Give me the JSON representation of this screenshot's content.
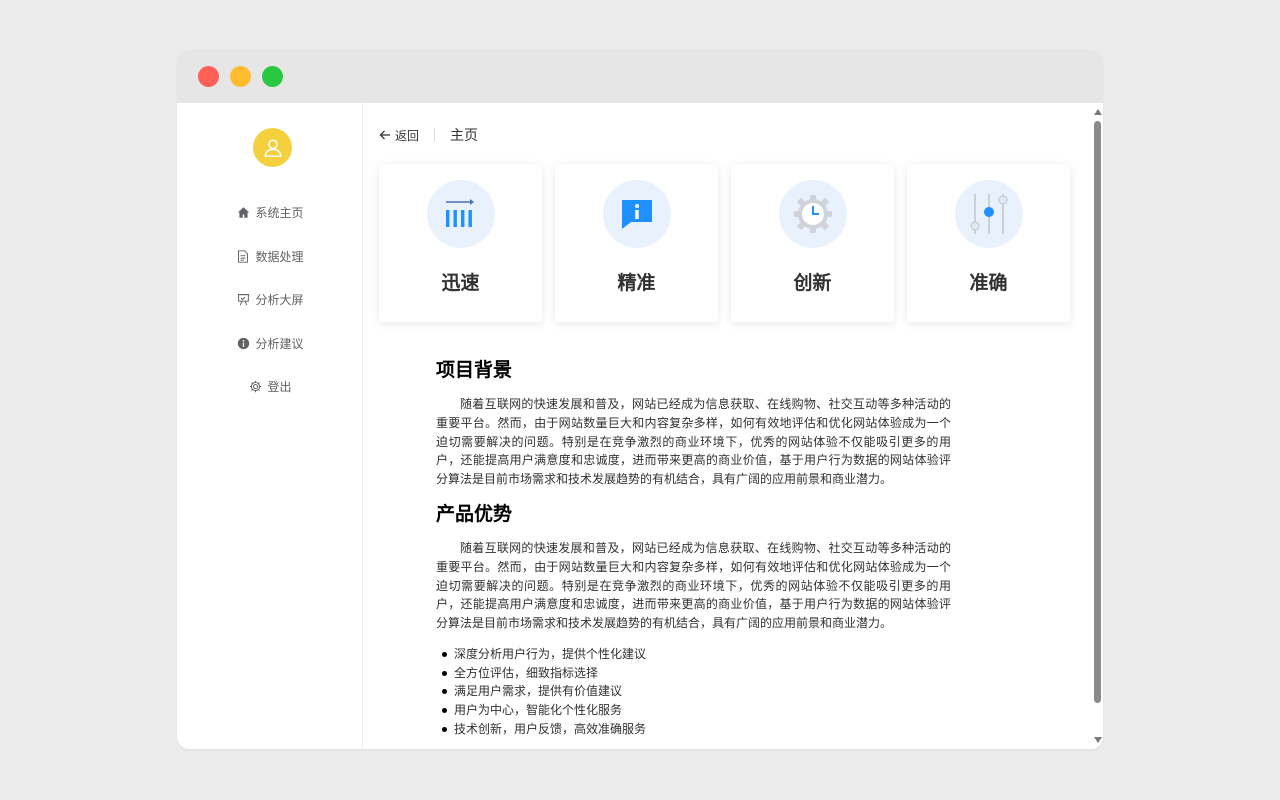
{
  "window": {
    "controls": [
      "close",
      "minimize",
      "maximize"
    ]
  },
  "sidebar": {
    "avatar_icon": "user-icon",
    "avatar_color": "#f4d03f",
    "items": [
      {
        "label": "系统主页",
        "icon": "home-icon"
      },
      {
        "label": "数据处理",
        "icon": "document-icon"
      },
      {
        "label": "分析大屏",
        "icon": "presentation-icon"
      },
      {
        "label": "分析建议",
        "icon": "info-icon"
      },
      {
        "label": "登出",
        "icon": "gear-icon"
      }
    ]
  },
  "header": {
    "back_label": "返回",
    "title": "主页"
  },
  "cards": [
    {
      "label": "迅速",
      "icon": "bar-chart-arrow-icon"
    },
    {
      "label": "精准",
      "icon": "info-chat-icon"
    },
    {
      "label": "创新",
      "icon": "clock-gear-icon"
    },
    {
      "label": "准确",
      "icon": "sliders-icon"
    }
  ],
  "accent_color": "#1e90ff",
  "article": {
    "sections": [
      {
        "heading": "项目背景",
        "paragraph": "随着互联网的快速发展和普及，网站已经成为信息获取、在线购物、社交互动等多种活动的重要平台。然而，由于网站数量巨大和内容复杂多样，如何有效地评估和优化网站体验成为一个迫切需要解决的问题。特别是在竞争激烈的商业环境下，优秀的网站体验不仅能吸引更多的用户，还能提高用户满意度和忠诚度，进而带来更高的商业价值，基于用户行为数据的网站体验评分算法是目前市场需求和技术发展趋势的有机结合，具有广阔的应用前景和商业潜力。"
      },
      {
        "heading": "产品优势",
        "paragraph": "随着互联网的快速发展和普及，网站已经成为信息获取、在线购物、社交互动等多种活动的重要平台。然而，由于网站数量巨大和内容复杂多样，如何有效地评估和优化网站体验成为一个迫切需要解决的问题。特别是在竞争激烈的商业环境下，优秀的网站体验不仅能吸引更多的用户，还能提高用户满意度和忠诚度，进而带来更高的商业价值，基于用户行为数据的网站体验评分算法是目前市场需求和技术发展趋势的有机结合，具有广阔的应用前景和商业潜力。"
      }
    ],
    "bullets": [
      "深度分析用户行为，提供个性化建议",
      "全方位评估，细致指标选择",
      "满足用户需求，提供有价值建议",
      "用户为中心，智能化个性化服务",
      "技术创新，用户反馈，高效准确服务"
    ]
  }
}
